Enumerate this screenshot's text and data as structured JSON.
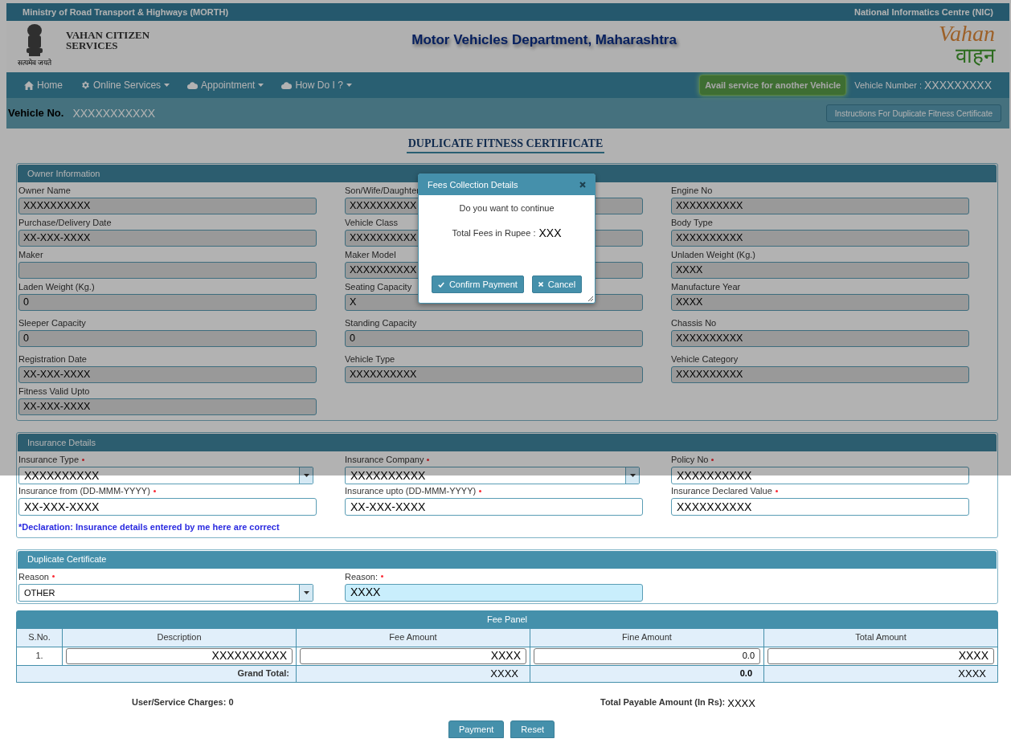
{
  "top_bar": {
    "left": "Ministry of Road Transport & Highways (MORTH)",
    "right": "National Informatics Centre (NIC)"
  },
  "header": {
    "emblem_caption": "सत्यमेव जयते",
    "brand": [
      "VAHAN CITIZEN",
      "SERVICES"
    ],
    "title": "Motor Vehicles Department, Maharashtra",
    "logo": [
      "Vahan",
      "वाहन"
    ]
  },
  "nav": {
    "items": [
      {
        "label": "Home",
        "kind": "home",
        "dropdown": false
      },
      {
        "label": "Online Services",
        "kind": "settings",
        "dropdown": true
      },
      {
        "label": "Appointment",
        "kind": "cloud",
        "dropdown": true
      },
      {
        "label": "How Do I ?",
        "kind": "cloud",
        "dropdown": true
      }
    ],
    "avail_button": "Avail service for another Vehicle",
    "vehicle_number_label": "Vehicle Number :",
    "vehicle_number": "XXXXXXXXX"
  },
  "vehicle_bar": {
    "label": "Vehicle No.",
    "value": "XXXXXXXXXXX",
    "instructions_button": "Instructions For Duplicate Fitness Certificate"
  },
  "page_title": "DUPLICATE FITNESS CERTIFICATE",
  "owner_information": {
    "title": "Owner Information",
    "fields": [
      {
        "label": "Owner Name",
        "value": "XXXXXXXXXX"
      },
      {
        "label": "Son/Wife/Daughter",
        "value": "XXXXXXXXXX"
      },
      {
        "label": "Engine No",
        "value": "XXXXXXXXXX"
      },
      {
        "label": "Purchase/Delivery Date",
        "value": "XX-XXX-XXXX"
      },
      {
        "label": "Vehicle Class",
        "value": "XXXXXXXXXX"
      },
      {
        "label": "Body Type",
        "value": "XXXXXXXXXX"
      },
      {
        "label": "Maker"
      },
      {
        "label": "Maker Model",
        "value": "XXXXXXXXXX"
      },
      {
        "label": "Unladen Weight (Kg.)",
        "value": "XXXX"
      },
      {
        "label": "Laden Weight (Kg.)",
        "value": "0"
      },
      {
        "label": "Seating Capacity",
        "value": "X"
      },
      {
        "label": "Manufacture Year",
        "value": "XXXX"
      },
      {
        "label": "Sleeper Capacity",
        "value": "0"
      },
      {
        "label": "Standing Capacity",
        "value": "0"
      },
      {
        "label": "Chassis No",
        "value": "XXXXXXXXXX"
      },
      {
        "label": "Registration Date",
        "value": "XX-XXX-XXXX"
      },
      {
        "label": "Vehicle Type",
        "value": "XXXXXXXXXX"
      },
      {
        "label": "Vehicle Category",
        "value": "XXXXXXXXXX"
      },
      {
        "label": "Fitness Valid Upto",
        "value": "XX-XXX-XXXX"
      }
    ]
  },
  "insurance_details": {
    "title": "Insurance Details",
    "fields": [
      {
        "label": "Insurance Type",
        "required": true,
        "kind": "select",
        "value": "XXXXXXXXXX"
      },
      {
        "label": "Insurance Company",
        "required": true,
        "kind": "select",
        "value": "XXXXXXXXXX"
      },
      {
        "label": "Policy No",
        "required": true,
        "kind": "input",
        "value": "XXXXXXXXXX"
      },
      {
        "label": "Insurance from (DD-MMM-YYYY)",
        "required": true,
        "kind": "input",
        "value": "XX-XXX-XXXX"
      },
      {
        "label": "Insurance upto (DD-MMM-YYYY)",
        "required": true,
        "kind": "input",
        "value": "XX-XXX-XXXX"
      },
      {
        "label": "Insurance Declared Value",
        "required": true,
        "kind": "input",
        "value": "XXXXXXXXXX"
      }
    ],
    "declaration": "*Declaration: Insurance details entered by me here are correct"
  },
  "duplicate_certificate": {
    "title": "Duplicate Certificate",
    "fields": [
      {
        "label": "Reason",
        "required": true,
        "kind": "select",
        "value": "OTHER",
        "focused": false
      },
      {
        "label": "Reason:",
        "required": true,
        "kind": "input",
        "value": "XXXX",
        "focused": true
      }
    ]
  },
  "fee_panel": {
    "title": "Fee Panel",
    "columns": [
      "S.No.",
      "Description",
      "Fee Amount",
      "Fine Amount",
      "Total Amount"
    ],
    "row": [
      "1.",
      "XXXXXXXXXX",
      "XXXX",
      "0.0",
      "XXXX"
    ],
    "grand_total": {
      "label": "Grand Total:",
      "values": [
        "XXXX",
        "0.0",
        "XXXX"
      ]
    }
  },
  "charges": {
    "service_charges": "User/Service Charges: 0",
    "total_payable_label": "Total Payable Amount (In Rs):",
    "total_payable": "XXXX"
  },
  "buttons": [
    "Payment",
    "Reset"
  ],
  "dialog": {
    "title": "Fees Collection Details",
    "message": "Do you want to continue",
    "total_label": "Total Fees in Rupee :",
    "total_value": "XXX",
    "buttons": [
      {
        "label": "Confirm Payment",
        "kind": "confirm"
      },
      {
        "label": "Cancel",
        "kind": "cancel"
      }
    ]
  }
}
